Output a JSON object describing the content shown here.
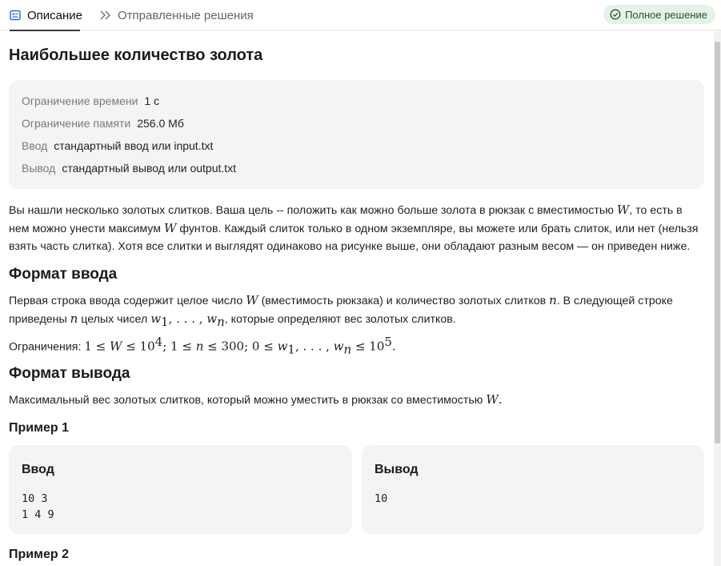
{
  "tabs": [
    {
      "label": "Описание",
      "icon": "description-icon",
      "active": true
    },
    {
      "label": "Отправленные решения",
      "icon": "chevrons-right-icon",
      "active": false
    }
  ],
  "status": {
    "label": "Полное решение",
    "icon": "check-circle-icon",
    "color": "#e3f4e6"
  },
  "title": "Наибольшее количество золота",
  "limits": [
    {
      "label": "Ограничение времени",
      "value": "1 с"
    },
    {
      "label": "Ограничение памяти",
      "value": "256.0 Мб"
    },
    {
      "label": "Ввод",
      "value": "стандартный ввод или input.txt"
    },
    {
      "label": "Вывод",
      "value": "стандартный вывод или output.txt"
    }
  ],
  "statement": {
    "p1": "Вы нашли несколько золотых слитков. Ваша цель -- положить как можно больше золота в рюкзак с вместимостью",
    "p2": ", то есть в нем можно унести максимум",
    "p3": "фунтов. Каждый слиток только в одном экземпляре, вы можете или брать слиток, или нет (нельзя взять часть слитка). Хотя все слитки и выглядят одинаково на рисунке выше, они обладают разным весом — он приведен ниже."
  },
  "input_format": {
    "heading": "Формат ввода",
    "p1": "Первая строка ввода содержит целое число",
    "p2": "(вместимость рюкзака) и количество золотых слитков",
    "p3": ". В следующей строке приведены",
    "p4": "целых чисел",
    "p5": ", которые определяют вес золотых слитков.",
    "constraints_label": "Ограничения:"
  },
  "output_format": {
    "heading": "Формат вывода",
    "p1": "Максимальный вес золотых слитков, который можно уместить в рюкзак со вместимостью"
  },
  "examples": [
    {
      "title": "Пример 1",
      "input_label": "Ввод",
      "input": "10 3\n1 4 9",
      "output_label": "Вывод",
      "output": "10"
    },
    {
      "title": "Пример 2"
    }
  ]
}
